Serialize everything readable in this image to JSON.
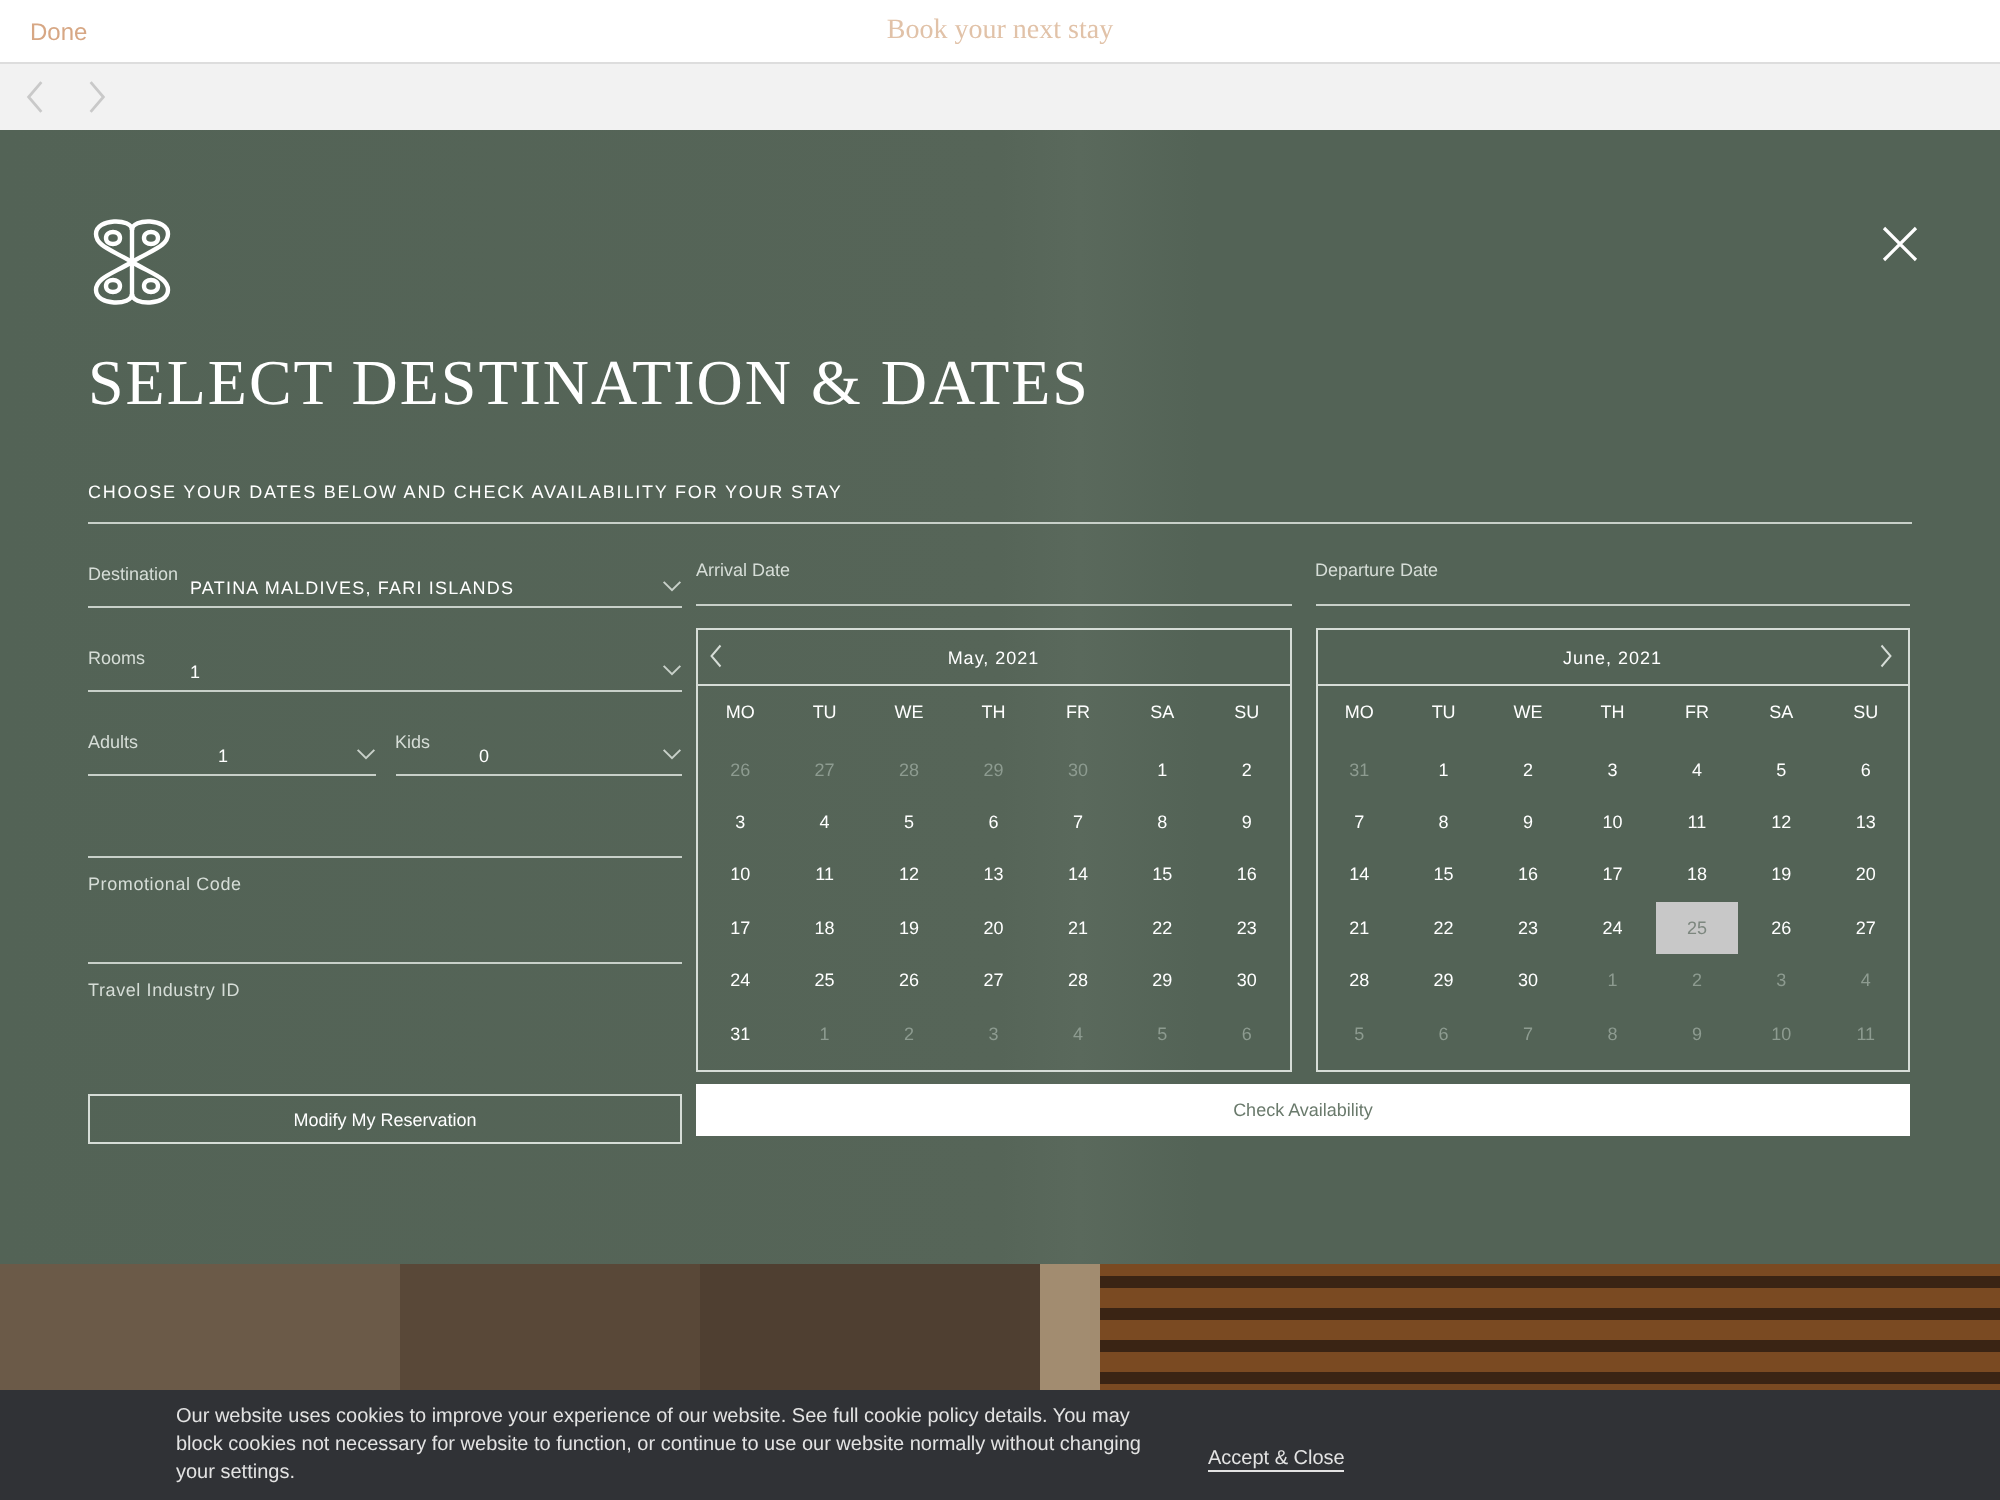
{
  "top_bar": {
    "done": "Done",
    "title": "Book your next stay"
  },
  "booking": {
    "title": "SELECT DESTINATION & DATES",
    "subtitle": "CHOOSE YOUR DATES BELOW AND CHECK AVAILABILITY FOR YOUR STAY",
    "selects": [
      {
        "fields": [
          {
            "label": "Destination",
            "value": "PATINA MALDIVES, FARI ISLANDS"
          }
        ]
      },
      {
        "fields": [
          {
            "label": "Rooms",
            "value": "1"
          }
        ]
      },
      {
        "fields": [
          {
            "label": "Adults",
            "value": "1"
          },
          {
            "label": "Kids",
            "value": "0"
          }
        ]
      }
    ],
    "inputs": [
      {
        "label": "Promotional Code",
        "underlined": true
      },
      {
        "label": "Travel Industry ID",
        "underlined": false
      }
    ],
    "modify_button": "Modify My Reservation",
    "date_fields": [
      "Arrival Date",
      "Departure Date"
    ],
    "calendars": [
      {
        "title": "May, 2021",
        "kind": "prev_nav",
        "weekdays": [
          "MO",
          "TU",
          "WE",
          "TH",
          "FR",
          "SA",
          "SU"
        ],
        "weeks": [
          [
            {
              "d": "26",
              "muted": true
            },
            {
              "d": "27",
              "muted": true
            },
            {
              "d": "28",
              "muted": true
            },
            {
              "d": "29",
              "muted": true
            },
            {
              "d": "30",
              "muted": true
            },
            {
              "d": "1"
            },
            {
              "d": "2"
            }
          ],
          [
            {
              "d": "3"
            },
            {
              "d": "4"
            },
            {
              "d": "5"
            },
            {
              "d": "6"
            },
            {
              "d": "7"
            },
            {
              "d": "8"
            },
            {
              "d": "9"
            }
          ],
          [
            {
              "d": "10"
            },
            {
              "d": "11"
            },
            {
              "d": "12"
            },
            {
              "d": "13"
            },
            {
              "d": "14"
            },
            {
              "d": "15"
            },
            {
              "d": "16"
            }
          ],
          [
            {
              "d": "17"
            },
            {
              "d": "18"
            },
            {
              "d": "19"
            },
            {
              "d": "20"
            },
            {
              "d": "21"
            },
            {
              "d": "22"
            },
            {
              "d": "23"
            }
          ],
          [
            {
              "d": "24"
            },
            {
              "d": "25"
            },
            {
              "d": "26"
            },
            {
              "d": "27"
            },
            {
              "d": "28"
            },
            {
              "d": "29"
            },
            {
              "d": "30"
            }
          ],
          [
            {
              "d": "31"
            },
            {
              "d": "1",
              "muted": true
            },
            {
              "d": "2",
              "muted": true
            },
            {
              "d": "3",
              "muted": true
            },
            {
              "d": "4",
              "muted": true
            },
            {
              "d": "5",
              "muted": true
            },
            {
              "d": "6",
              "muted": true
            }
          ]
        ]
      },
      {
        "title": "June, 2021",
        "kind": "next_nav",
        "weekdays": [
          "MO",
          "TU",
          "WE",
          "TH",
          "FR",
          "SA",
          "SU"
        ],
        "weeks": [
          [
            {
              "d": "31",
              "muted": true
            },
            {
              "d": "1"
            },
            {
              "d": "2"
            },
            {
              "d": "3"
            },
            {
              "d": "4"
            },
            {
              "d": "5"
            },
            {
              "d": "6"
            }
          ],
          [
            {
              "d": "7"
            },
            {
              "d": "8"
            },
            {
              "d": "9"
            },
            {
              "d": "10"
            },
            {
              "d": "11"
            },
            {
              "d": "12"
            },
            {
              "d": "13"
            }
          ],
          [
            {
              "d": "14"
            },
            {
              "d": "15"
            },
            {
              "d": "16"
            },
            {
              "d": "17"
            },
            {
              "d": "18"
            },
            {
              "d": "19"
            },
            {
              "d": "20"
            }
          ],
          [
            {
              "d": "21"
            },
            {
              "d": "22"
            },
            {
              "d": "23"
            },
            {
              "d": "24"
            },
            {
              "d": "25",
              "selected": true
            },
            {
              "d": "26"
            },
            {
              "d": "27"
            }
          ],
          [
            {
              "d": "28"
            },
            {
              "d": "29"
            },
            {
              "d": "30"
            },
            {
              "d": "1",
              "muted": true
            },
            {
              "d": "2",
              "muted": true
            },
            {
              "d": "3",
              "muted": true
            },
            {
              "d": "4",
              "muted": true
            }
          ],
          [
            {
              "d": "5",
              "muted": true
            },
            {
              "d": "6",
              "muted": true
            },
            {
              "d": "7",
              "muted": true
            },
            {
              "d": "8",
              "muted": true
            },
            {
              "d": "9",
              "muted": true
            },
            {
              "d": "10",
              "muted": true
            },
            {
              "d": "11",
              "muted": true
            }
          ]
        ]
      }
    ],
    "check_button": "Check Availability"
  },
  "cookie_banner": {
    "text": "Our website uses cookies to improve your experience of our website. See full cookie policy details. You may block cookies not necessary for website to function, or continue to use our website normally without changing your settings.",
    "accept": "Accept & Close"
  }
}
